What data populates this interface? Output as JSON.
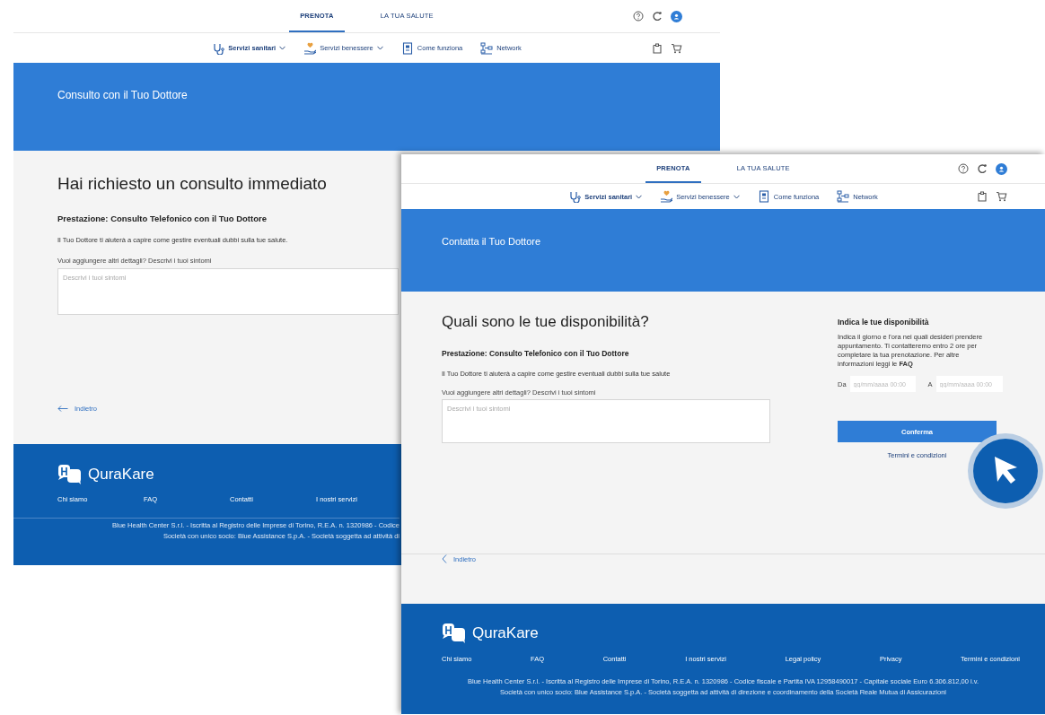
{
  "windows": [
    {
      "kind": "request",
      "tabs": [
        {
          "label": "PRENOTA",
          "selected": true
        },
        {
          "label": "LA TUA SALUTE",
          "selected": false
        }
      ],
      "menu": [
        {
          "label": "Servizi sanitari",
          "kind": "dropdown",
          "selected": true
        },
        {
          "label": "Servizi benessere",
          "kind": "dropdown",
          "selected": false
        },
        {
          "label": "Come funziona",
          "kind": "link",
          "selected": false
        },
        {
          "label": "Network",
          "kind": "link",
          "selected": false
        }
      ],
      "banner_title": "Consulto con il Tuo Dottore",
      "heading": "Hai richiesto un consulto immediato",
      "service": "Prestazione: Consulto Telefonico con il Tuo Dottore",
      "description": "Il Tuo Dottore ti aiuterà a capire come gestire eventuali dubbi sulla tue salute.",
      "details_label": "Vuoi aggiungere altri dettagli? Descrivi i tuoi sintomi",
      "details_placeholder": "Descrivi i tuoi sintomi",
      "back_link": "Indietro",
      "footer": {
        "brand": "QuraKare",
        "links": [
          "Chi siamo",
          "FAQ",
          "Contatti",
          "I nostri servizi"
        ],
        "legal": [
          "Blue Health Center S.r.l. - Iscritta al Registro delle Imprese di Torino, R.E.A. n. 1320986 - Codice",
          "Società con unico socio: Blue Assistance S.p.A. - Società soggetta ad attività di"
        ]
      }
    },
    {
      "kind": "availability",
      "tabs": [
        {
          "label": "PRENOTA",
          "selected": true
        },
        {
          "label": "LA TUA SALUTE",
          "selected": false
        }
      ],
      "menu": [
        {
          "label": "Servizi sanitari",
          "kind": "dropdown",
          "selected": true
        },
        {
          "label": "Servizi benessere",
          "kind": "dropdown",
          "selected": false
        },
        {
          "label": "Come funziona",
          "kind": "link",
          "selected": false
        },
        {
          "label": "Network",
          "kind": "link",
          "selected": false
        }
      ],
      "banner_title": "Contatta il Tuo Dottore",
      "heading": "Quali sono le tue disponibilità?",
      "service": "Prestazione: Consulto Telefonico con il Tuo Dottore",
      "description": "Il Tuo Dottore ti aiuterà a capire come gestire eventuali dubbi sulla tue salute",
      "details_label": "Vuoi aggiungere altri dettagli? Descrivi i tuoi sintomi",
      "details_placeholder": "Descrivi i tuoi sintomi",
      "availability": {
        "title": "Indica le tue disponibilità",
        "text": "Indica il giorno e l'ora nei quali desideri prendere appuntamento. Ti contatteremo entro 2 ore per completare la tua prenotazione. Per altre informazioni leggi le **FAQ**",
        "from_label": "Da",
        "from_placeholder": "gg/mm/aaaa 00:00",
        "to_label": "A",
        "to_placeholder": "gg/mm/aaaa 00:00",
        "confirm": "Conferma",
        "terms": "Termini e condizioni"
      },
      "back_link": "Indietro",
      "footer": {
        "brand": "QuraKare",
        "links": [
          "Chi siamo",
          "FAQ",
          "Contatti",
          "I nostri servizi",
          "Legal policy",
          "Privacy",
          "Termini e condizioni"
        ],
        "legal": [
          "Blue Health Center S.r.l. - Iscritta al Registro delle Imprese di Torino, R.E.A. n. 1320986 - Codice fiscale e Partita IVA 12958490017 - Capitale sociale Euro 6.306.812,00 i.v.",
          "Società con unico socio: Blue Assistance S.p.A. - Società soggetta ad attività di direzione e coordinamento della Società Reale Mutua di Assicurazioni"
        ]
      }
    }
  ]
}
